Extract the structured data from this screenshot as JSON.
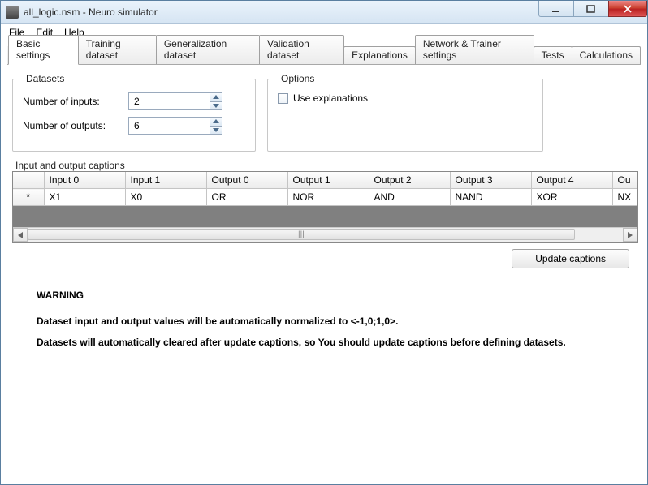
{
  "window": {
    "title": "all_logic.nsm - Neuro simulator"
  },
  "menubar": [
    "File",
    "Edit",
    "Help"
  ],
  "tabs": [
    "Basic settings",
    "Training dataset",
    "Generalization dataset",
    "Validation dataset",
    "Explanations",
    "Network & Trainer settings",
    "Tests",
    "Calculations"
  ],
  "active_tab_index": 0,
  "datasets": {
    "legend": "Datasets",
    "inputs_label": "Number of inputs:",
    "inputs_value": "2",
    "outputs_label": "Number of outputs:",
    "outputs_value": "6"
  },
  "options": {
    "legend": "Options",
    "use_explanations_label": "Use explanations",
    "use_explanations_checked": false
  },
  "captions": {
    "legend": "Input and output captions",
    "columns": [
      "Input 0",
      "Input 1",
      "Output 0",
      "Output 1",
      "Output 2",
      "Output 3",
      "Output 4",
      "Ou"
    ],
    "row_marker": "*",
    "row": [
      "X1",
      "X0",
      "OR",
      "NOR",
      "AND",
      "NAND",
      "XOR",
      "NX"
    ]
  },
  "buttons": {
    "update_captions": "Update captions"
  },
  "warning": {
    "heading": "WARNING",
    "line1": "Dataset input and output values will be automatically normalized to <-1,0;1,0>.",
    "line2": "Datasets will automatically cleared after update captions, so You should update captions before defining datasets."
  }
}
